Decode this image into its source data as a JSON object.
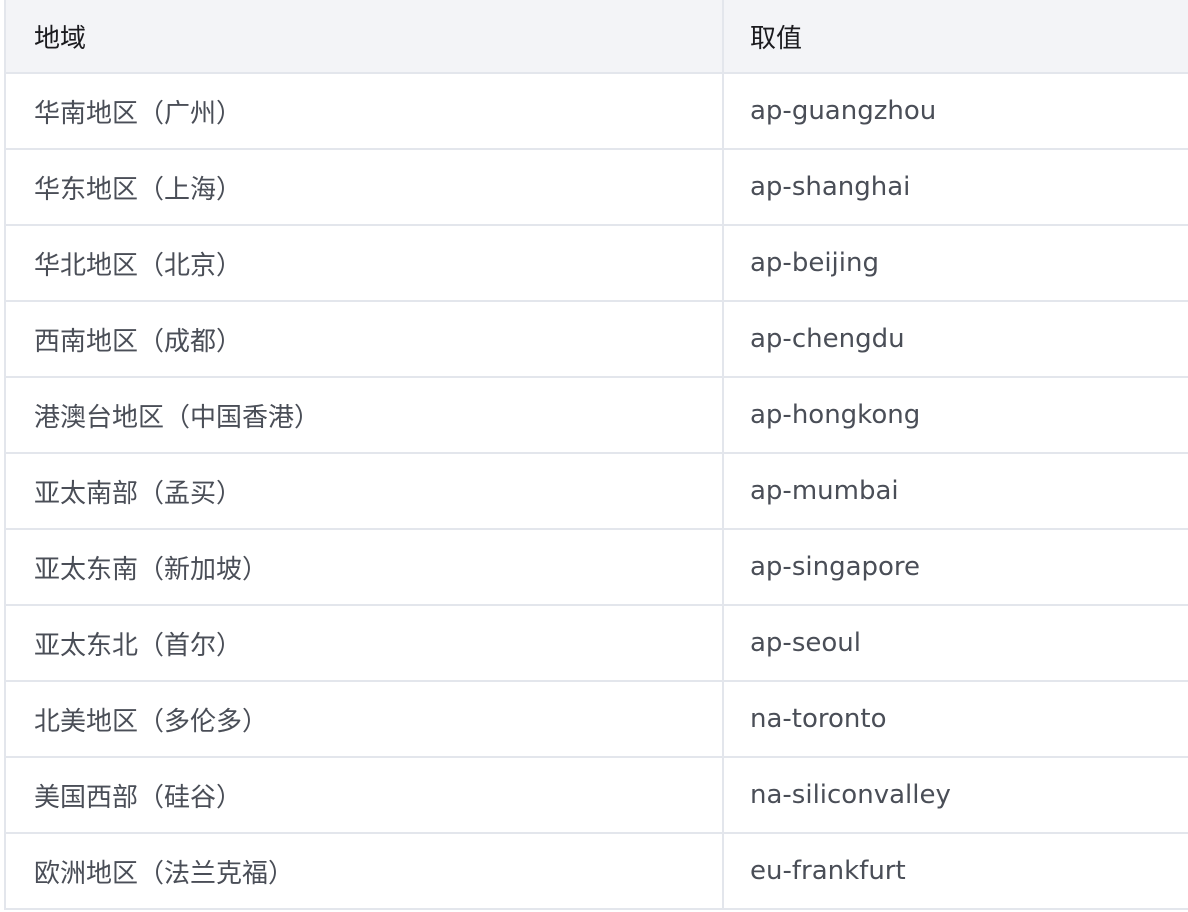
{
  "table": {
    "headers": {
      "region": "地域",
      "value": "取值"
    },
    "rows": [
      {
        "region": "华南地区（广州）",
        "value": "ap-guangzhou"
      },
      {
        "region": "华东地区（上海）",
        "value": "ap-shanghai"
      },
      {
        "region": "华北地区（北京）",
        "value": "ap-beijing"
      },
      {
        "region": "西南地区（成都）",
        "value": "ap-chengdu"
      },
      {
        "region": "港澳台地区（中国香港）",
        "value": "ap-hongkong"
      },
      {
        "region": "亚太南部（孟买）",
        "value": "ap-mumbai"
      },
      {
        "region": "亚太东南（新加坡）",
        "value": "ap-singapore"
      },
      {
        "region": "亚太东北（首尔）",
        "value": "ap-seoul"
      },
      {
        "region": "北美地区（多伦多）",
        "value": "na-toronto"
      },
      {
        "region": "美国西部（硅谷）",
        "value": "na-siliconvalley"
      },
      {
        "region": "欧洲地区（法兰克福）",
        "value": "eu-frankfurt"
      }
    ]
  }
}
